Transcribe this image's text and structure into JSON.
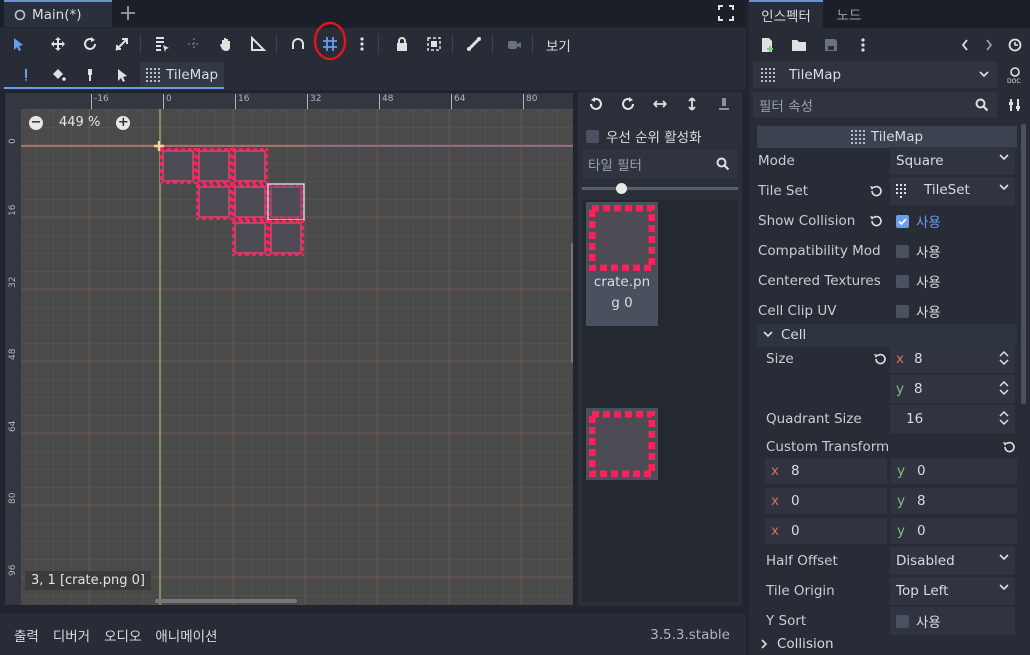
{
  "scene_tab": {
    "label": "Main(*)"
  },
  "toolbar": {
    "view_label": "보기"
  },
  "subbar": {
    "tilemap_label": "TileMap"
  },
  "viewport": {
    "zoom": "449 %",
    "coords": "3, 1 [crate.png 0]",
    "ruler_top": [
      "-16",
      "0",
      "16",
      "32",
      "48",
      "64",
      "80"
    ],
    "ruler_left": [
      "0",
      "16",
      "32",
      "48",
      "64",
      "80",
      "96"
    ]
  },
  "palette": {
    "priority_label": "우선 순위 활성화",
    "filter_placeholder": "타일 필터",
    "tile1_name": "crate.png 0",
    "tile1_line1": "crate.pn",
    "tile1_line2": "g 0"
  },
  "bottom": {
    "output": "출력",
    "debugger": "디버거",
    "audio": "오디오",
    "animation": "애니메이션",
    "version": "3.5.3.stable"
  },
  "inspector": {
    "tab_inspector": "인스펙터",
    "tab_node": "노드",
    "node_type": "TileMap",
    "filter_placeholder": "필터 속성",
    "section_title": "TileMap",
    "on_label": "사용",
    "props": {
      "mode": {
        "label": "Mode",
        "value": "Square"
      },
      "tile_set": {
        "label": "Tile Set",
        "value": "TileSet"
      },
      "show_collision": {
        "label": "Show Collision"
      },
      "compat": {
        "label": "Compatibility Mod"
      },
      "centered": {
        "label": "Centered Textures"
      },
      "clip_uv": {
        "label": "Cell Clip UV"
      },
      "cell": {
        "label": "Cell"
      },
      "size": {
        "label": "Size",
        "x": "8",
        "y": "8"
      },
      "quadrant": {
        "label": "Quadrant Size",
        "value": "16"
      },
      "custom_transform": {
        "label": "Custom Transform",
        "r1": [
          "8",
          "0"
        ],
        "r2": [
          "0",
          "8"
        ],
        "r3": [
          "0",
          "0"
        ]
      },
      "half_offset": {
        "label": "Half Offset",
        "value": "Disabled"
      },
      "tile_origin": {
        "label": "Tile Origin",
        "value": "Top Left"
      },
      "y_sort": {
        "label": "Y Sort"
      },
      "collision": {
        "label": "Collision"
      }
    },
    "axis_x": "x",
    "axis_y": "y"
  },
  "colors": {
    "accent": "#6a9cf0",
    "crate": "#ff1f5a",
    "highlight_circle": "#e5141b"
  }
}
